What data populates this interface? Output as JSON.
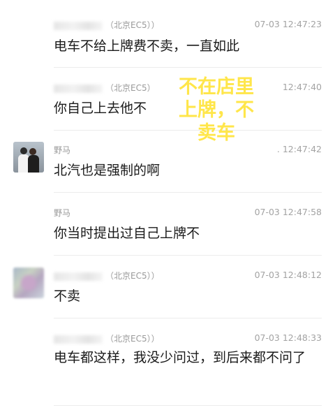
{
  "messages": [
    {
      "sender": "（北京EC5））",
      "time": "07-03 12:47:23",
      "text": "电车不给上牌费不卖，一直如此",
      "avatar": "none"
    },
    {
      "sender": "（北京EC5）",
      "time": "12:47:40",
      "text": "你自己上去他不",
      "avatar": "none"
    },
    {
      "sender": "野马",
      "time": ". 12:47:42",
      "text": "北汽也是强制的啊",
      "avatar": "photo"
    },
    {
      "sender": "野马",
      "time": "07-03 12:47:58",
      "text": "你当时提出过自己上牌不",
      "avatar": "none"
    },
    {
      "sender": "（北京EC5））",
      "time": "07-03 12:48:12",
      "text": "不卖",
      "avatar": "blur"
    },
    {
      "sender": "（北京EC5））",
      "time": "07-03 12:48:33",
      "text": "电车都这样，我没少问过，到后来都不问了",
      "avatar": "none"
    }
  ],
  "overlay_text": "不在店里上牌，不卖车",
  "colors": {
    "overlay": "#ffe64a",
    "meta": "#9a9a9a",
    "text": "#1a1a1a"
  }
}
